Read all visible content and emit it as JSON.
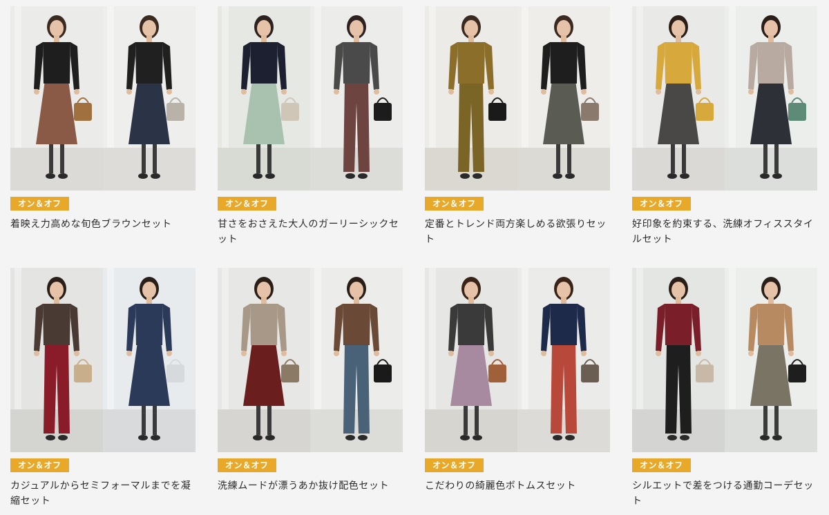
{
  "cards": [
    {
      "badge": "オン＆オフ",
      "title": "着映え力高めな旬色ブラウンセット",
      "looks": [
        {
          "bg": "#ebebe9",
          "floor": "#dcdad6",
          "top": "#1e1e1e",
          "bottom": "#8a5a46",
          "bottom_type": "skirt",
          "bag": "#a0703e",
          "hair": "#3a2a20"
        },
        {
          "bg": "#eeeeec",
          "floor": "#dedcd8",
          "top": "#202020",
          "bottom": "#2b3346",
          "bottom_type": "skirt",
          "bag": "#b8b2a8",
          "hair": "#3a2a20"
        }
      ]
    },
    {
      "badge": "オン＆オフ",
      "title": "甘さをおさえた大人のガーリーシックセット",
      "looks": [
        {
          "bg": "#e6e8e4",
          "floor": "#d8dad4",
          "top": "#1c2030",
          "bottom": "#a9c2b0",
          "bottom_type": "skirt",
          "bag": "#cfc6b8",
          "hair": "#2e2220"
        },
        {
          "bg": "#ecedea",
          "floor": "#dcddd8",
          "top": "#4a4a4a",
          "bottom": "#6e4440",
          "bottom_type": "pants",
          "bag": "#1c1c1c",
          "hair": "#2e2220"
        }
      ]
    },
    {
      "badge": "オン＆オフ",
      "title": "定番とトレンド両方楽しめる欲張りセット",
      "looks": [
        {
          "bg": "#ecebe8",
          "floor": "#dbd8d2",
          "top": "#8a6e2a",
          "bottom": "#7a6426",
          "bottom_type": "pants",
          "bag": "#1a1a1a",
          "hair": "#3a2a20"
        },
        {
          "bg": "#eeedea",
          "floor": "#dcdad4",
          "top": "#1e1e1e",
          "bottom": "#5a5c54",
          "bottom_type": "skirt",
          "bag": "#8a7a6e",
          "hair": "#3a2a20"
        }
      ]
    },
    {
      "badge": "オン＆オフ",
      "title": "好印象を約束する、洗練オフィススタイルセット",
      "looks": [
        {
          "bg": "#e9e9e7",
          "floor": "#dad9d5",
          "top": "#d7a93c",
          "bottom": "#4a4846",
          "bottom_type": "skirt",
          "bag": "#d7a93c",
          "hair": "#2a1e18"
        },
        {
          "bg": "#eceeec",
          "floor": "#dcdedc",
          "top": "#b8aaa0",
          "bottom": "#2e3038",
          "bottom_type": "skirt",
          "bag": "#5e8a78",
          "hair": "#2a1e18"
        }
      ]
    },
    {
      "badge": "オン＆オフ",
      "title": "カジュアルからセミフォーマルまでを凝縮セット",
      "looks": [
        {
          "bg": "#e4e5e3",
          "floor": "#d4d4d0",
          "top": "#4a3a34",
          "bottom": "#8a1c2a",
          "bottom_type": "pants",
          "bag": "#c8ae8a",
          "hair": "#2a1e18"
        },
        {
          "bg": "#e8ebee",
          "floor": "#d8dadc",
          "top": "#2c3a5a",
          "bottom": "#2c3a5a",
          "bottom_type": "skirt",
          "bag": "#d6dadc",
          "hair": "#2a1e18"
        }
      ]
    },
    {
      "badge": "オン＆オフ",
      "title": "洗練ムードが漂うあか抜け配色セット",
      "looks": [
        {
          "bg": "#e7e7e5",
          "floor": "#d6d5d1",
          "top": "#a89888",
          "bottom": "#6a1e1e",
          "bottom_type": "skirt",
          "bag": "#8a7a66",
          "hair": "#2a1e18"
        },
        {
          "bg": "#ecedeb",
          "floor": "#dcdcd8",
          "top": "#6a4a36",
          "bottom": "#4a6278",
          "bottom_type": "pants",
          "bag": "#1a1a1a",
          "hair": "#2a1e18"
        }
      ]
    },
    {
      "badge": "オン＆オフ",
      "title": "こだわりの綺麗色ボトムスセット",
      "looks": [
        {
          "bg": "#e6e6e4",
          "floor": "#d6d5d0",
          "top": "#3a3a3a",
          "bottom": "#a88aa0",
          "bottom_type": "skirt",
          "bag": "#a0603a",
          "hair": "#3a2418"
        },
        {
          "bg": "#ebebe9",
          "floor": "#dcdbd7",
          "top": "#1e2a4a",
          "bottom": "#b8483a",
          "bottom_type": "pants",
          "bag": "#6a5e52",
          "hair": "#3a2418"
        }
      ]
    },
    {
      "badge": "オン＆オフ",
      "title": "シルエットで差をつける通勤コーデセット",
      "looks": [
        {
          "bg": "#e4e6e4",
          "floor": "#d4d5d2",
          "top": "#7a1e2a",
          "bottom": "#1e1e1e",
          "bottom_type": "pants",
          "bag": "#c8b8a8",
          "hair": "#2a1e18"
        },
        {
          "bg": "#eceeec",
          "floor": "#dcdedc",
          "top": "#b88a62",
          "bottom": "#7a7464",
          "bottom_type": "skirt",
          "bag": "#1e1e1e",
          "hair": "#2a1e18"
        }
      ]
    }
  ]
}
